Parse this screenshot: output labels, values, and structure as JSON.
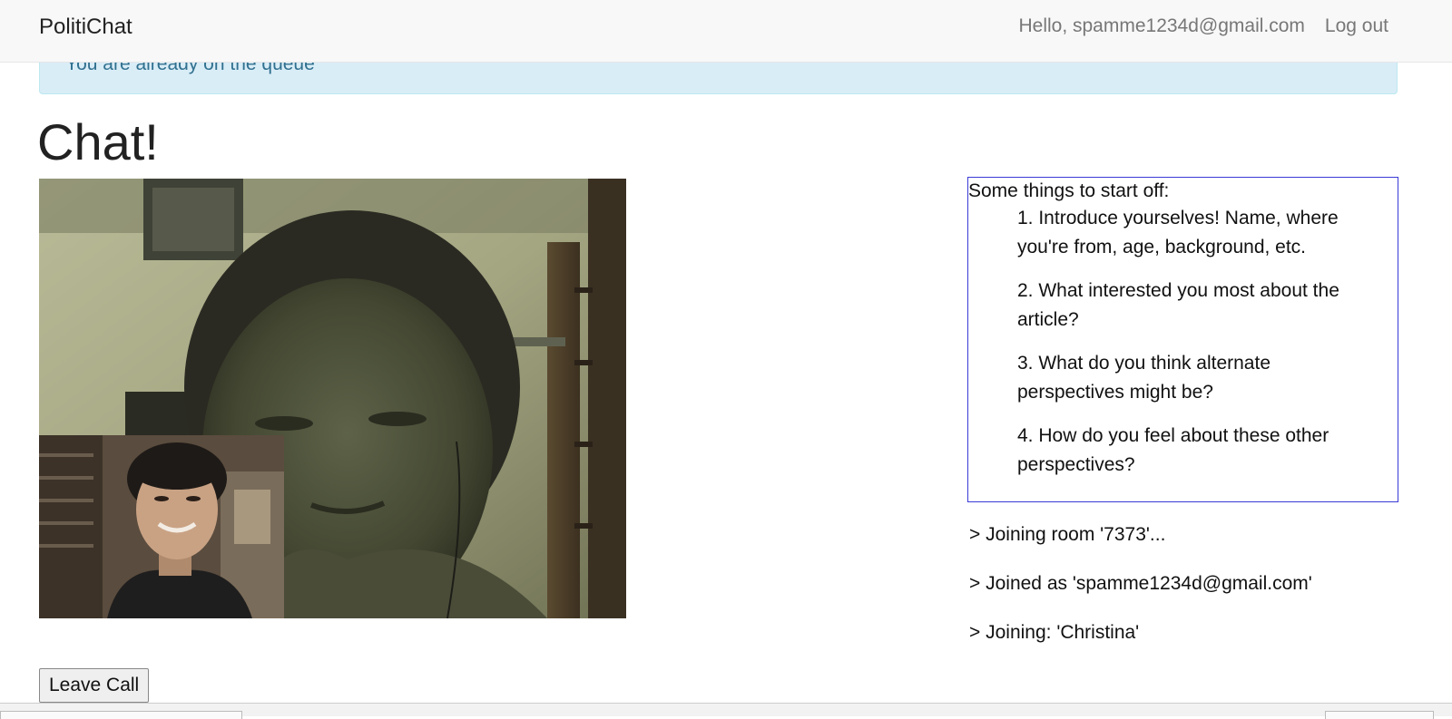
{
  "navbar": {
    "brand": "PolitiChat",
    "greeting": "Hello, spamme1234d@gmail.com",
    "logout": "Log out"
  },
  "alert": {
    "message": "You are already on the queue"
  },
  "page": {
    "title": "Chat!"
  },
  "tips": {
    "heading": "Some things to start off:",
    "items": [
      "1. Introduce yourselves! Name, where you're from, age, background, etc.",
      "2. What interested you most about the article?",
      "3. What do you think alternate perspectives might be?",
      "4. How do you feel about these other perspectives?"
    ]
  },
  "log": {
    "lines": [
      "> Joining room '7373'...",
      "> Joined as 'spamme1234d@gmail.com'",
      "> Joining: 'Christina'"
    ]
  },
  "controls": {
    "leave_label": "Leave Call"
  },
  "colors": {
    "navbar_bg": "#f8f8f8",
    "alert_bg": "#d9edf7",
    "alert_text": "#31708f",
    "tips_border": "#3a3ad8"
  }
}
